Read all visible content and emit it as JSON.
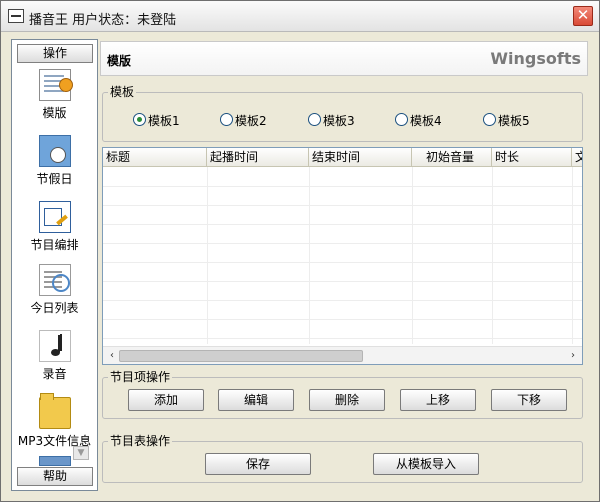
{
  "window": {
    "title": "播音王  用户状态：未登陆",
    "close_glyph": "✕"
  },
  "sidebar": {
    "header": "操作",
    "footer": "帮助",
    "items": [
      {
        "label": "模版",
        "icon": "template-icon"
      },
      {
        "label": "节假日",
        "icon": "holiday-icon"
      },
      {
        "label": "节目编排",
        "icon": "schedule-icon"
      },
      {
        "label": "今日列表",
        "icon": "today-list-icon"
      },
      {
        "label": "录音",
        "icon": "record-music-icon"
      },
      {
        "label": "MP3文件信息",
        "icon": "folder-icon"
      },
      {
        "label": "",
        "icon": "partial-icon"
      }
    ],
    "scroll_glyph": "▼"
  },
  "header": {
    "title": "模版",
    "brand": "Wingsofts"
  },
  "template_group": {
    "legend": "模板",
    "options": [
      "模板1",
      "模板2",
      "模板3",
      "模板4",
      "模板5"
    ],
    "selected": "模板1"
  },
  "table": {
    "columns": [
      "标题",
      "起播时间",
      "结束时间",
      "初始音量",
      "时长",
      "文"
    ],
    "rows": [],
    "scroll_left": "‹",
    "scroll_right": "›"
  },
  "item_ops": {
    "legend": "节目项操作",
    "buttons": [
      "添加",
      "编辑",
      "删除",
      "上移",
      "下移"
    ]
  },
  "table_ops": {
    "legend": "节目表操作",
    "buttons": [
      "保存",
      "从模板导入"
    ]
  },
  "colors": {
    "radio_selected": "#2b8d3a",
    "close_button": "#d94a36",
    "brand_text": "#7a7a7a"
  }
}
